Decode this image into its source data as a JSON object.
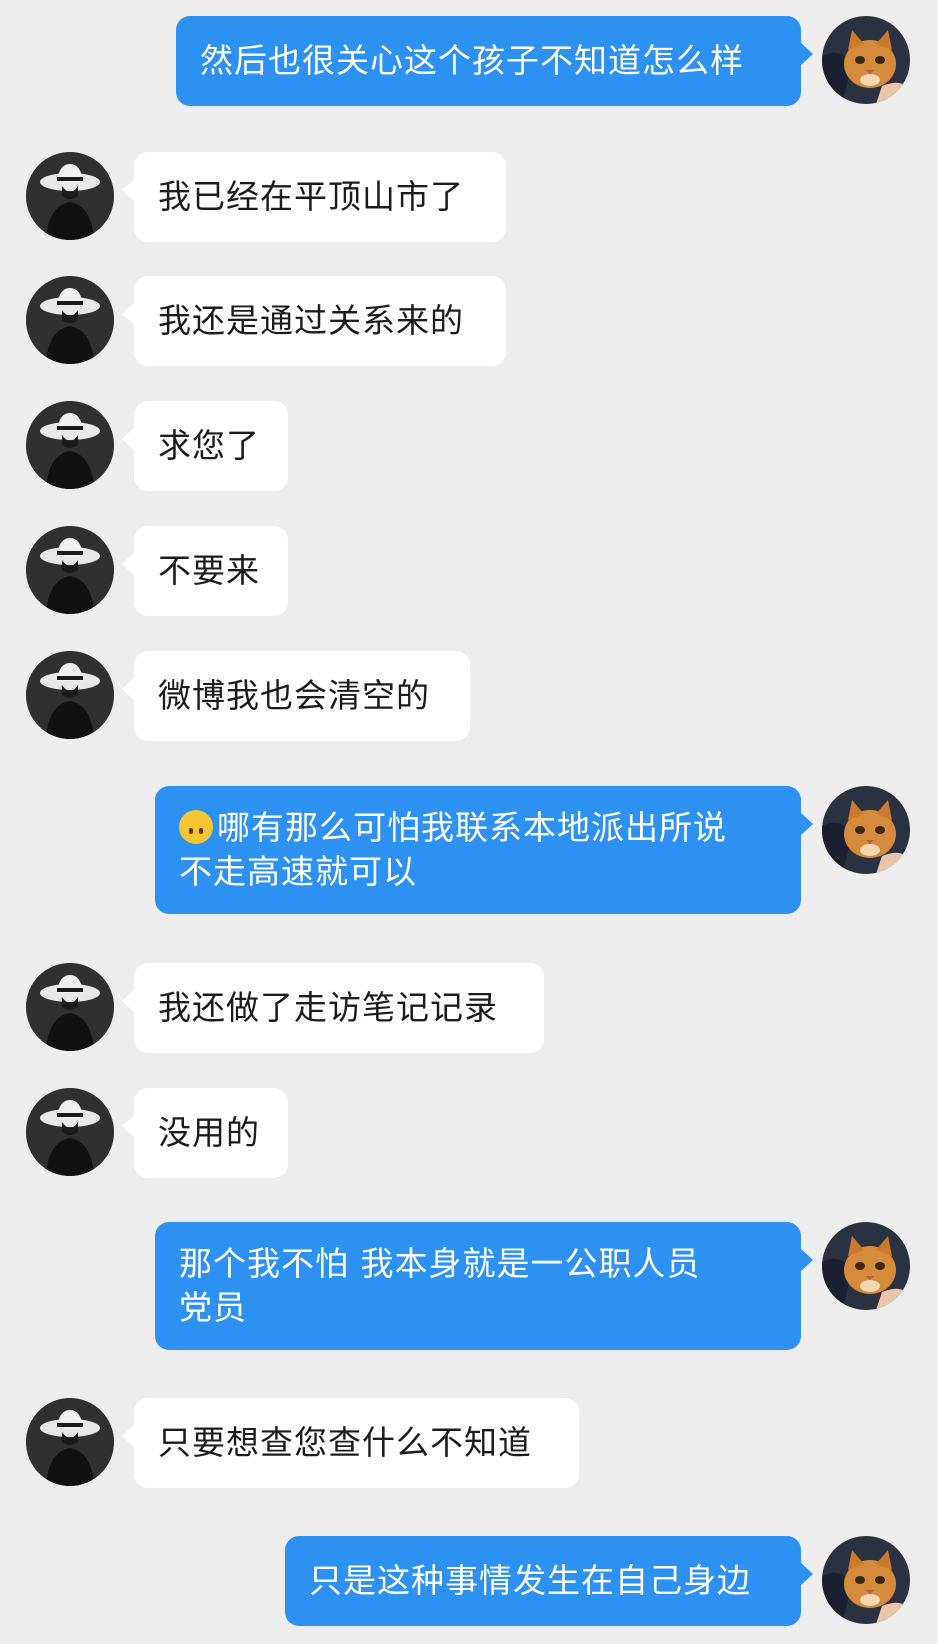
{
  "messages": [
    {
      "side": "out",
      "text": "然后也很关心这个孩子不知道怎么样"
    },
    {
      "side": "in",
      "text": "我已经在平顶山市了"
    },
    {
      "side": "in",
      "text": "我还是通过关系来的"
    },
    {
      "side": "in",
      "text": "求您了"
    },
    {
      "side": "in",
      "text": "不要来"
    },
    {
      "side": "in",
      "text": "微博我也会清空的"
    },
    {
      "side": "out",
      "emoji": "upside-down-face",
      "line1": "哪有那么可怕我联系本地派出所说",
      "line2": "不走高速就可以"
    },
    {
      "side": "in",
      "text": "我还做了走访笔记记录"
    },
    {
      "side": "in",
      "text": "没用的"
    },
    {
      "side": "out",
      "line1": "那个我不怕 我本身就是一公职人员",
      "line2": "党员"
    },
    {
      "side": "in",
      "text": "只要想查您查什么不知道"
    },
    {
      "side": "out",
      "text": "只是这种事情发生在自己身边"
    }
  ],
  "avatars": {
    "contact": "avatar-man-in-hat",
    "self": "avatar-orange-cat"
  },
  "colors": {
    "background": "#ededed",
    "incoming_bubble": "#ffffff",
    "outgoing_bubble": "#2d91f2",
    "outgoing_text": "#ffffff"
  }
}
